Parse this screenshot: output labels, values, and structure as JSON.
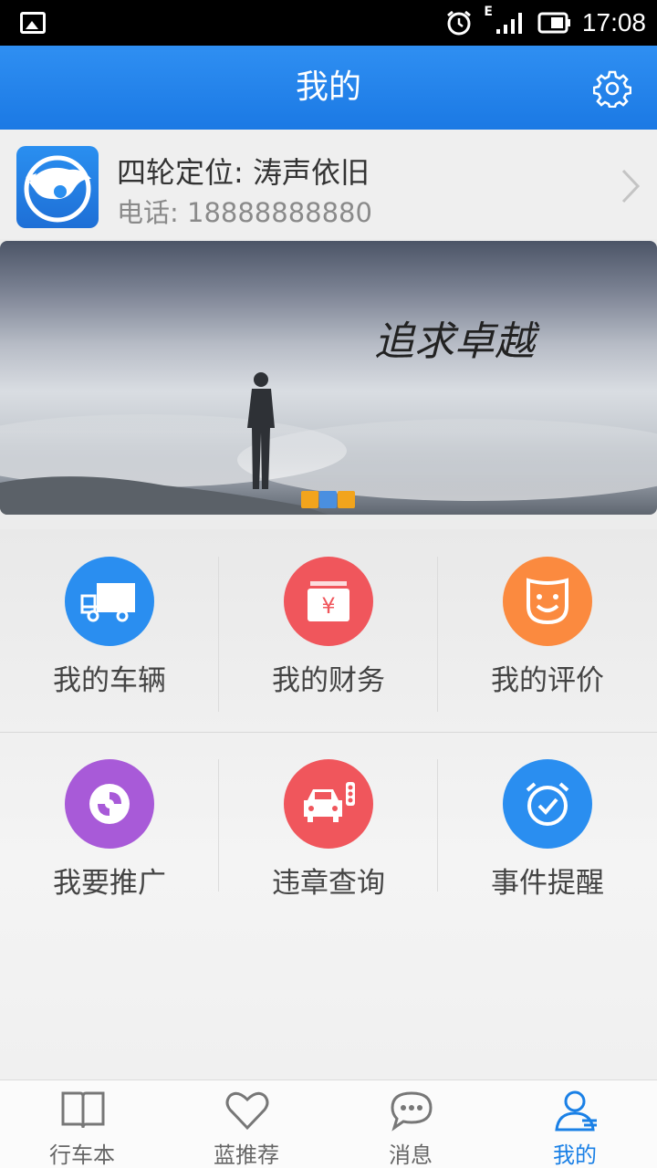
{
  "status_bar": {
    "time": "17:08",
    "network": "E"
  },
  "app_bar": {
    "title": "我的"
  },
  "profile": {
    "name": "四轮定位: 涛声依旧",
    "phone": "电话: 18888888880"
  },
  "banner": {
    "slogan_line": "追求卓越"
  },
  "menu": [
    {
      "label": "我的车辆",
      "color": "#2a8ef0",
      "icon": "truck-icon"
    },
    {
      "label": "我的财务",
      "color": "#f0565c",
      "icon": "wallet-icon"
    },
    {
      "label": "我的评价",
      "color": "#fb8a3f",
      "icon": "smile-face-icon"
    },
    {
      "label": "我要推广",
      "color": "#a85ad8",
      "icon": "promote-icon"
    },
    {
      "label": "违章查询",
      "color": "#f0565c",
      "icon": "car-traffic-light-icon"
    },
    {
      "label": "事件提醒",
      "color": "#2a8ef0",
      "icon": "alarm-clock-icon"
    }
  ],
  "bottom_nav": [
    {
      "label": "行车本",
      "icon": "book-icon",
      "active": false
    },
    {
      "label": "蓝推荐",
      "icon": "heart-icon",
      "active": false
    },
    {
      "label": "消息",
      "icon": "chat-bubble-icon",
      "active": false
    },
    {
      "label": "我的",
      "icon": "user-icon",
      "active": true
    }
  ],
  "colors": {
    "primary": "#1a80e6",
    "accent_active": "#1a80e6"
  }
}
